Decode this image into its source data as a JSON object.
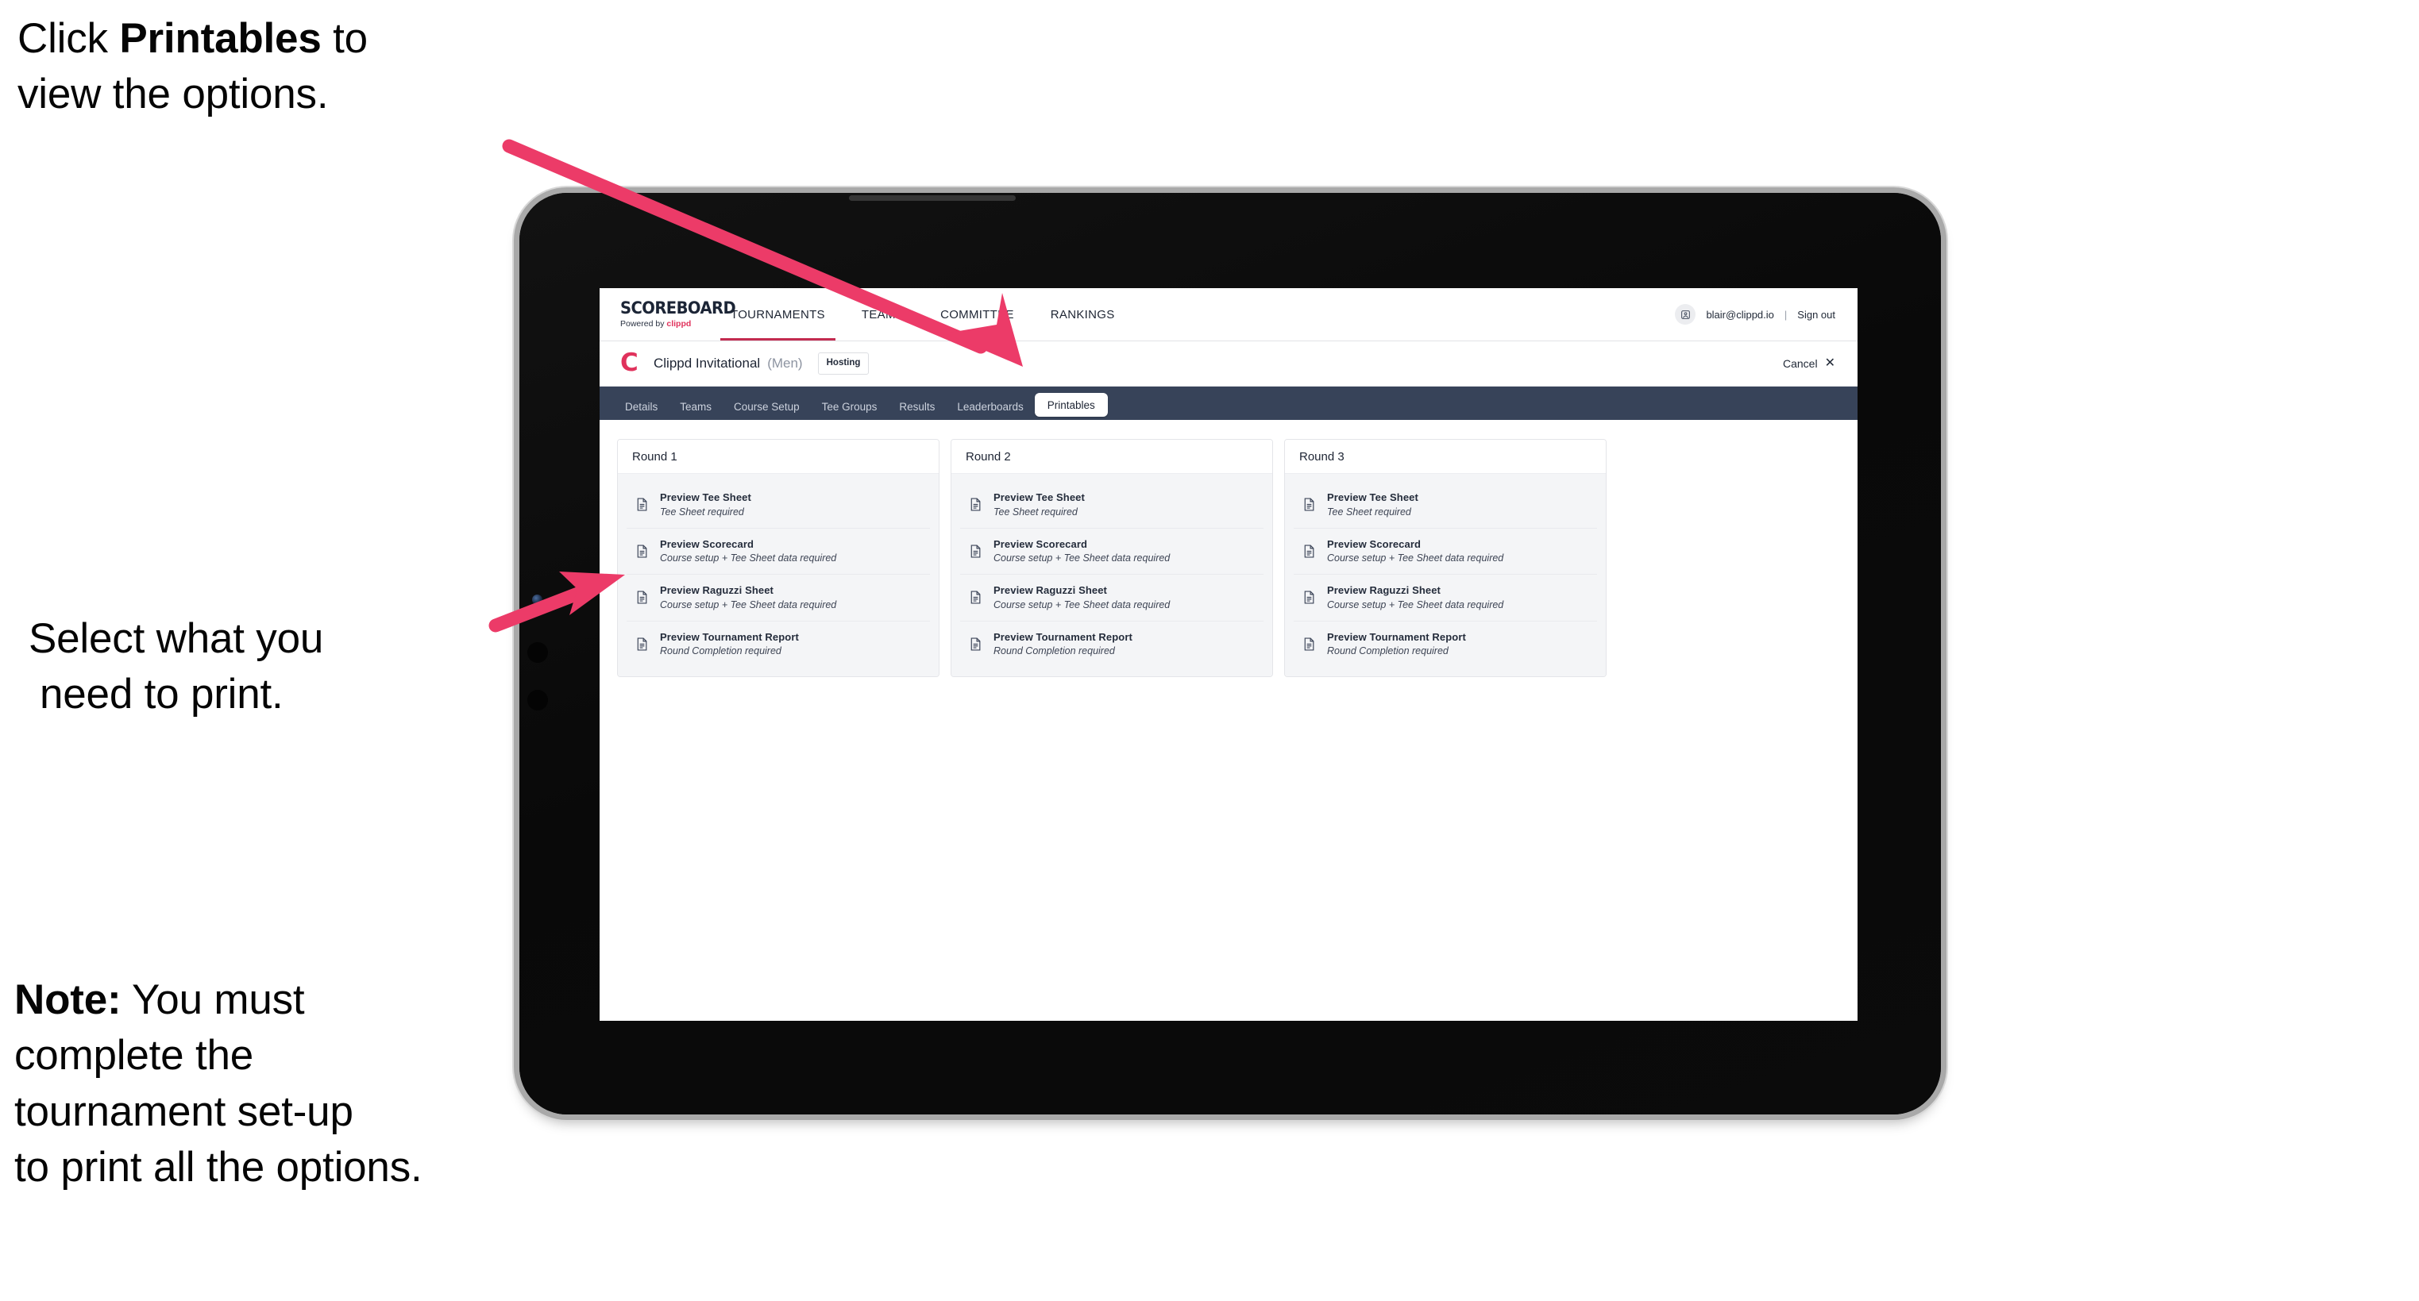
{
  "annotations": {
    "top": {
      "before": "Click ",
      "bold": "Printables",
      "after": " to\nview the options."
    },
    "middle_line1": "Select what you",
    "middle_line2": "need to print.",
    "note": {
      "bold": "Note:",
      "rest": " You must\ncomplete the\ntournament set-up\nto print all the options."
    }
  },
  "colors": {
    "arrow": "#EC3B68",
    "tabstrip": "#374359",
    "accent": "#E0325C",
    "topnav_underline": "#C32B50"
  },
  "app": {
    "brand": {
      "name": "SCOREBOARD",
      "powered_by": "Powered by ",
      "powered_by_brand": "clippd"
    },
    "topnav": [
      {
        "label": "TOURNAMENTS",
        "active": true
      },
      {
        "label": "TEAMS",
        "active": false
      },
      {
        "label": "COMMITTEE",
        "active": false
      },
      {
        "label": "RANKINGS",
        "active": false
      }
    ],
    "account": {
      "avatar_icon": "user-avatar-icon",
      "email": "blair@clippd.io",
      "separator": "|",
      "sign_out": "Sign out"
    },
    "tournament": {
      "logo_letter": "C",
      "name": "Clippd Invitational",
      "gender": "(Men)",
      "status_chip": "Hosting",
      "cancel": "Cancel",
      "cancel_icon": "close-icon"
    },
    "tabs": [
      {
        "label": "Details",
        "active": false
      },
      {
        "label": "Teams",
        "active": false
      },
      {
        "label": "Course Setup",
        "active": false
      },
      {
        "label": "Tee Groups",
        "active": false
      },
      {
        "label": "Results",
        "active": false
      },
      {
        "label": "Leaderboards",
        "active": false
      },
      {
        "label": "Printables",
        "active": true
      }
    ],
    "rounds": [
      {
        "title": "Round 1",
        "documents": [
          {
            "title": "Preview Tee Sheet",
            "requirement": "Tee Sheet required"
          },
          {
            "title": "Preview Scorecard",
            "requirement": "Course setup + Tee Sheet data required"
          },
          {
            "title": "Preview Raguzzi Sheet",
            "requirement": "Course setup + Tee Sheet data required"
          },
          {
            "title": "Preview Tournament Report",
            "requirement": "Round Completion required"
          }
        ]
      },
      {
        "title": "Round 2",
        "documents": [
          {
            "title": "Preview Tee Sheet",
            "requirement": "Tee Sheet required"
          },
          {
            "title": "Preview Scorecard",
            "requirement": "Course setup + Tee Sheet data required"
          },
          {
            "title": "Preview Raguzzi Sheet",
            "requirement": "Course setup + Tee Sheet data required"
          },
          {
            "title": "Preview Tournament Report",
            "requirement": "Round Completion required"
          }
        ]
      },
      {
        "title": "Round 3",
        "documents": [
          {
            "title": "Preview Tee Sheet",
            "requirement": "Tee Sheet required"
          },
          {
            "title": "Preview Scorecard",
            "requirement": "Course setup + Tee Sheet data required"
          },
          {
            "title": "Preview Raguzzi Sheet",
            "requirement": "Course setup + Tee Sheet data required"
          },
          {
            "title": "Preview Tournament Report",
            "requirement": "Round Completion required"
          }
        ]
      }
    ]
  }
}
